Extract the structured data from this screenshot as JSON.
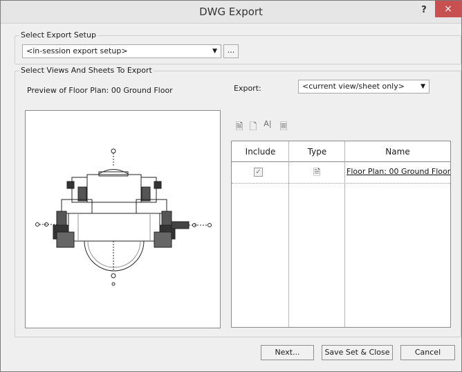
{
  "window": {
    "title": "DWG Export",
    "help_label": "?",
    "close_label": "×"
  },
  "export_setup": {
    "group_label": "Select Export Setup",
    "selected": "<in-session export setup>",
    "browse_label": "..."
  },
  "views": {
    "group_label": "Select Views And Sheets To Export",
    "preview_label": "Preview of Floor Plan: 00 Ground Floor",
    "export_label": "Export:",
    "export_selected": "<current view/sheet only>",
    "toolbar_icons": [
      "check-all-icon",
      "check-none-icon",
      "rename-icon",
      "uncheck-icon"
    ]
  },
  "table": {
    "columns": [
      "Include",
      "Type",
      "Name"
    ],
    "rows": [
      {
        "include": true,
        "include_mark": "✓",
        "type_icon": "floor-plan-view-icon",
        "name": "Floor Plan: 00 Ground Floor"
      }
    ]
  },
  "buttons": {
    "next": "Next...",
    "save": "Save Set & Close",
    "cancel": "Cancel"
  }
}
